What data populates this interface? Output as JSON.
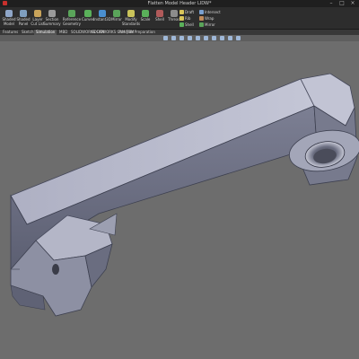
{
  "window": {
    "title": "Flatten Model Header LIDW*",
    "logo_icon": "app-logo-icon",
    "minimize_icon": "minimize-icon",
    "maximize_icon": "maximize-icon",
    "close_icon": "close-icon"
  },
  "ribbon": {
    "buttons": [
      {
        "label": "Shaded\nModel",
        "icon": "shaded-model-icon",
        "color": "#8fa6c8"
      },
      {
        "label": "Shaded\nPanel",
        "icon": "shaded-panel-icon",
        "color": "#7f9fc0"
      },
      {
        "label": "Layer\nCut List",
        "icon": "layer-icon",
        "color": "#c8a35a"
      },
      {
        "label": "Section\nSummary",
        "icon": "section-summary-icon",
        "color": "#9b9b9b"
      },
      {
        "label": "Reference\nGeometry",
        "icon": "reference-geometry-icon",
        "color": "#5aa45a"
      },
      {
        "label": "Curves",
        "icon": "curves-icon",
        "color": "#5ab05a"
      },
      {
        "label": "Instant3D",
        "icon": "instant3d-icon",
        "color": "#4a8fd0"
      },
      {
        "label": "Mirror",
        "icon": "mirror-icon",
        "color": "#5aa45a"
      },
      {
        "label": "Modify\nStandards",
        "icon": "modify-standards-icon",
        "color": "#c9c35a"
      },
      {
        "label": "Scale",
        "icon": "scale-icon",
        "color": "#5ab05a"
      },
      {
        "label": "Shell",
        "icon": "shell-icon",
        "color": "#b05a5a"
      },
      {
        "label": "Thread",
        "icon": "thread-icon",
        "color": "#8c8c8c"
      }
    ],
    "small": [
      {
        "label": "Draft",
        "icon": "draft-icon",
        "color": "#d8c45a"
      },
      {
        "label": "Rib",
        "icon": "rib-icon",
        "color": "#d8c45a"
      },
      {
        "label": "Shell",
        "icon": "shell-small-icon",
        "color": "#5ab05a"
      },
      {
        "label": "Intersect",
        "icon": "intersect-icon",
        "color": "#7aa0d0"
      },
      {
        "label": "Wrap",
        "icon": "wrap-icon",
        "color": "#c08a5a"
      },
      {
        "label": "Mirror",
        "icon": "mirror-small-icon",
        "color": "#5aa45a"
      }
    ]
  },
  "tabs": [
    {
      "label": "Features",
      "active": false
    },
    {
      "label": "Sketch",
      "active": false
    },
    {
      "label": "Simulation",
      "active": true
    },
    {
      "label": "MBD",
      "active": false
    },
    {
      "label": "SOLIDWORKS CAM",
      "active": false
    },
    {
      "label": "SOLIDWORKS CAM TBM",
      "active": false
    },
    {
      "label": "Analysis Preparation",
      "active": false
    }
  ],
  "view_toolbar": {
    "icons": [
      "zoom-fit-icon",
      "zoom-area-icon",
      "previous-view-icon",
      "section-view-icon",
      "view-orientation-icon",
      "display-style-icon",
      "hide-show-icon",
      "appearance-icon",
      "scene-icon",
      "view-settings-icon"
    ]
  },
  "colors": {
    "background": "#6d6d6d",
    "part_top": "#b9bbcc",
    "part_side": "#6a6d80",
    "part_front": "#8a8ca0"
  }
}
